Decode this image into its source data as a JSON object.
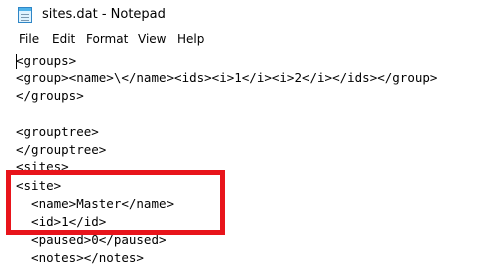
{
  "window": {
    "title": "sites.dat - Notepad",
    "icon": "notepad-icon"
  },
  "menu": {
    "items": [
      "File",
      "Edit",
      "Format",
      "View",
      "Help"
    ]
  },
  "editor": {
    "lines": [
      "<groups>",
      "<group><name>\\</name><ids><i>1</i><i>2</i></ids></group>",
      "</groups>",
      "",
      "<grouptree>",
      "</grouptree>",
      "<sites>",
      "<site>",
      "  <name>Master</name>",
      "  <id>1</id>",
      "  <paused>0</paused>",
      "  <notes></notes>"
    ]
  },
  "annotation": {
    "highlight_color": "#e8141b"
  }
}
